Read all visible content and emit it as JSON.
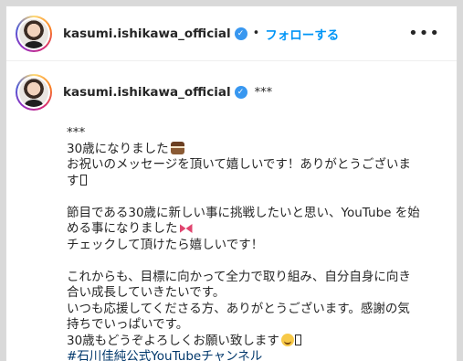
{
  "header": {
    "username": "kasumi.ishikawa_official",
    "dot": "•",
    "follow_label": "フォローする",
    "more_label": "•••"
  },
  "caption": {
    "username": "kasumi.ishikawa_official",
    "title": "***",
    "lines": {
      "l1": "***",
      "l2": "30歳になりました",
      "l3": "お祝いのメッセージを頂いて嬉しいです！ありがとうございま",
      "l4": "す",
      "l5": "節目である30歳に新しい事に挑戦したいと思い、YouTube を始",
      "l6": "める事になりました",
      "l7": "チェックして頂けたら嬉しいです！",
      "l8": "これからも、目標に向かって全力で取り組み、自分自身に向き",
      "l9": "合い成長していきたいです。",
      "l10": "いつも応援してくださる方、ありがとうございます。感謝の気",
      "l11": "持ちでいっぱいです。",
      "l12": "30歳もどうぞよろしくお願い致します",
      "hashtag": "#石川佳純公式YouTubeチャンネル"
    }
  },
  "icons": {
    "verified": "verified-badge-icon",
    "cake": "cake-emoji-icon",
    "ribbon": "ribbon-emoji-icon",
    "smile": "smiling-face-emoji-icon",
    "more": "more-options-icon"
  },
  "colors": {
    "link": "#0095f6",
    "hashtag": "#00376b",
    "verified": "#3897f0",
    "text": "#262626"
  }
}
